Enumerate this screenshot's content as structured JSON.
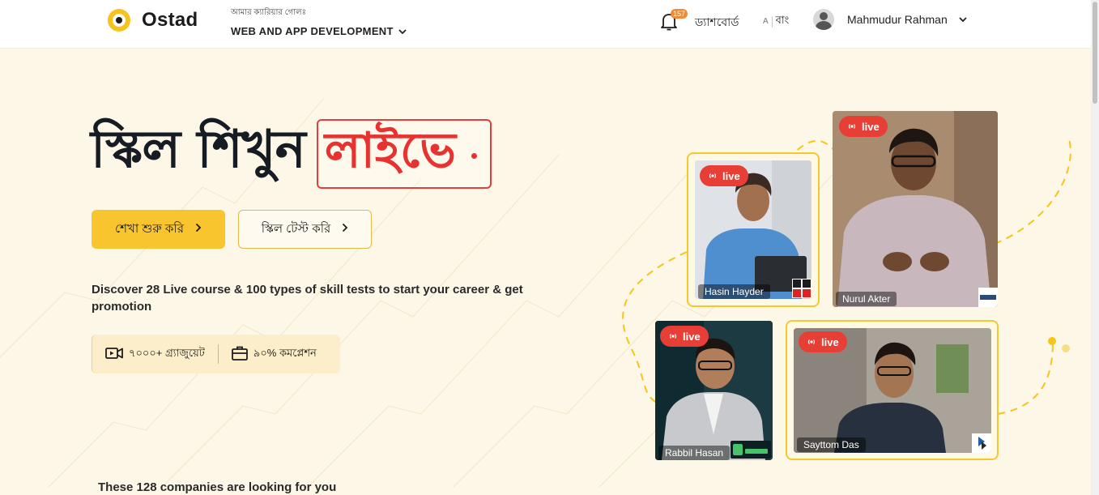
{
  "header": {
    "logo_text": "Ostad",
    "program_small": "আমার ক্যারিয়ার গোলঃ",
    "program_name": "WEB AND APP DEVELOPMENT",
    "notification_count": "157",
    "dashboard_label": "ড্যাশবোর্ড",
    "lang_en": "A",
    "lang_bn": "বাং",
    "user_name": "Mahmudur Rahman"
  },
  "hero": {
    "title_main": "স্কিল শিখুন",
    "title_highlight": "লাইভে",
    "primary_button": "শেখা শুরু করি",
    "secondary_button": "স্কিল টেস্ট করি",
    "description": "Discover 28 Live course & 100 types of skill tests to start your career & get promotion",
    "stat_graduates": "৭০০০+ গ্র্যাজুয়েট",
    "stat_completion": "৯০% কমপ্লেশন",
    "companies_text": "These 128 companies are looking for you"
  },
  "instructors": [
    {
      "name": "Hasin Hayder",
      "live_label": "live"
    },
    {
      "name": "Nurul Akter",
      "live_label": "live"
    },
    {
      "name": "Rabbil Hasan",
      "live_label": "live"
    },
    {
      "name": "Sayttom Das",
      "live_label": "live"
    }
  ],
  "colors": {
    "brand_yellow": "#f8c52f",
    "live_red": "#e73e35",
    "title_red": "#e8322f",
    "hero_bg": "#fdf7e7"
  }
}
